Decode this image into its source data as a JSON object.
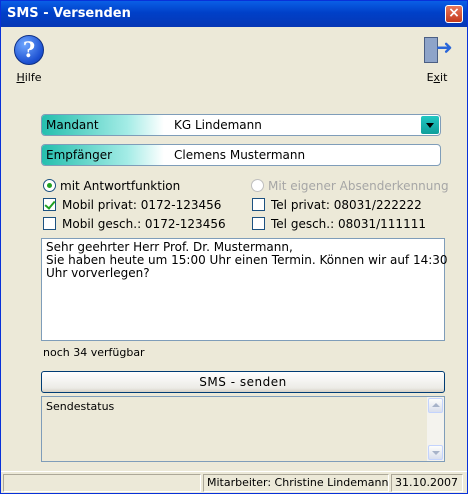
{
  "window": {
    "title": "SMS - Versenden",
    "close_glyph": "×"
  },
  "toolbar": {
    "help": {
      "icon": "help-icon",
      "glyph": "?",
      "label_u": "H",
      "label_rest": "ilfe"
    },
    "exit": {
      "icon": "exit-door-icon",
      "label_pre": "E",
      "label_u": "x",
      "label_rest": "it"
    }
  },
  "mandant": {
    "label": "Mandant",
    "value": "KG Lindemann"
  },
  "recipient": {
    "label": "Empfänger",
    "value": "Clemens Mustermann"
  },
  "options": {
    "reply": {
      "label": "mit Antwortfunktion",
      "selected": true
    },
    "sender_id": {
      "label": "Mit eigener Absenderkennung",
      "selected": false,
      "disabled": true
    }
  },
  "numbers": {
    "mobile_private": {
      "label": "Mobil privat: 0172-123456",
      "checked": true
    },
    "tel_private": {
      "label": "Tel privat: 08031/222222",
      "checked": false
    },
    "mobile_business": {
      "label": "Mobil gesch.: 0172-123456",
      "checked": false
    },
    "tel_business": {
      "label": "Tel gesch.: 08031/111111",
      "checked": false
    }
  },
  "message": {
    "line1": "Sehr geehrter Herr Prof. Dr. Mustermann,",
    "line2": "Sie haben heute um 15:00 Uhr einen Termin. Können wir auf 14:30",
    "line3": "Uhr vorverlegen?"
  },
  "remaining": "noch 34 verfügbar",
  "send_button": "SMS - senden",
  "send_status": "Sendestatus",
  "statusbar": {
    "employee": "Mitarbeiter:  Christine Lindemann",
    "date": "31.10.2007"
  },
  "colors": {
    "title_bar": "#0040c8",
    "field_label_accent": "#25bfae",
    "check_green": "#21a121"
  }
}
